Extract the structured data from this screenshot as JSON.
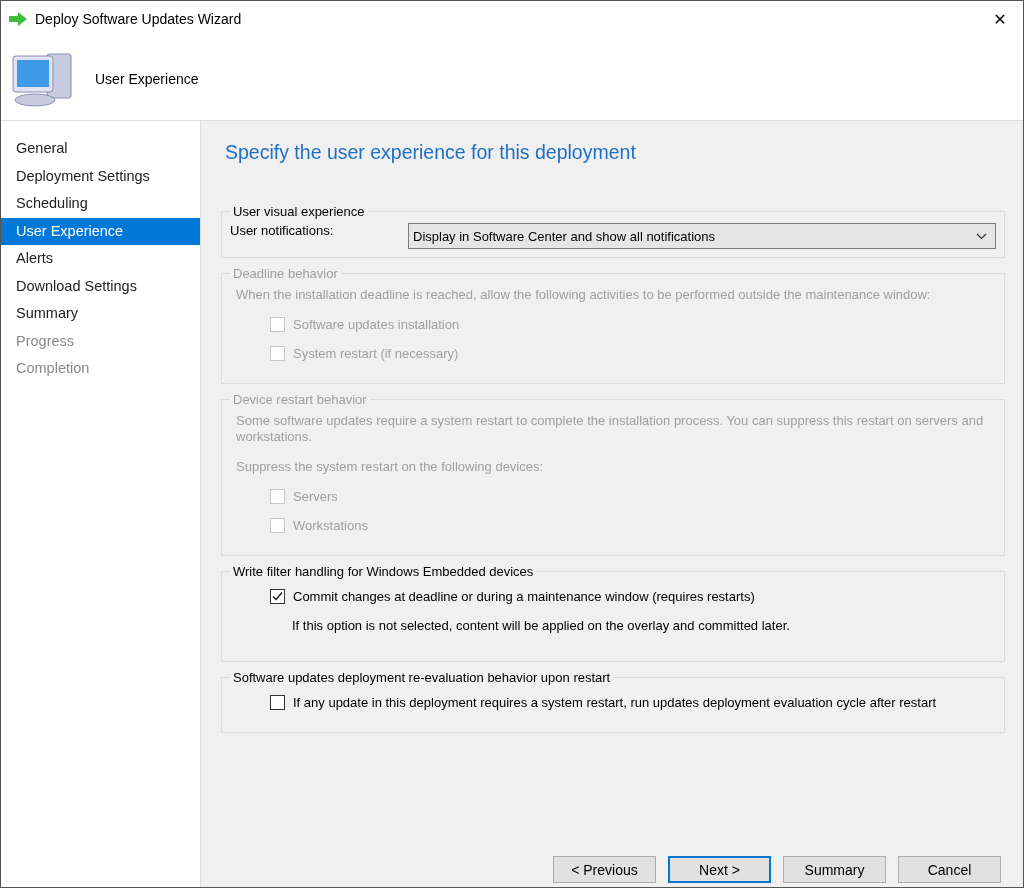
{
  "window": {
    "title": "Deploy Software Updates Wizard",
    "close": "✕"
  },
  "header": {
    "title": "User Experience"
  },
  "sidebar": {
    "items": [
      {
        "label": "General",
        "selected": false,
        "disabled": false
      },
      {
        "label": "Deployment Settings",
        "selected": false,
        "disabled": false
      },
      {
        "label": "Scheduling",
        "selected": false,
        "disabled": false
      },
      {
        "label": "User Experience",
        "selected": true,
        "disabled": false
      },
      {
        "label": "Alerts",
        "selected": false,
        "disabled": false
      },
      {
        "label": "Download Settings",
        "selected": false,
        "disabled": false
      },
      {
        "label": "Summary",
        "selected": false,
        "disabled": false
      },
      {
        "label": "Progress",
        "selected": false,
        "disabled": true
      },
      {
        "label": "Completion",
        "selected": false,
        "disabled": true
      }
    ]
  },
  "page": {
    "heading": "Specify the user experience for this deployment"
  },
  "groups": [
    {
      "legend": "User visual experience",
      "disabled": false,
      "items": [
        {
          "kind": "dropdown",
          "label": "User notifications:",
          "value": "Display in Software Center and show all notifications"
        }
      ]
    },
    {
      "legend": "Deadline behavior",
      "disabled": true,
      "items": [
        {
          "kind": "text",
          "text": "When the installation deadline is reached, allow the following activities to be performed outside the maintenance window:"
        },
        {
          "kind": "checkbox",
          "label": "Software updates installation",
          "checked": false
        },
        {
          "kind": "checkbox",
          "label": "System restart (if necessary)",
          "checked": false
        }
      ]
    },
    {
      "legend": "Device restart behavior",
      "disabled": true,
      "items": [
        {
          "kind": "text",
          "text": "Some software updates require a system restart to complete the installation process. You can suppress this restart on servers and workstations."
        },
        {
          "kind": "text",
          "text": "Suppress the system restart on the following devices:"
        },
        {
          "kind": "checkbox",
          "label": "Servers",
          "checked": false
        },
        {
          "kind": "checkbox",
          "label": "Workstations",
          "checked": false
        }
      ]
    },
    {
      "legend": "Write filter handling for Windows Embedded devices",
      "disabled": false,
      "items": [
        {
          "kind": "checkbox",
          "label": "Commit changes at deadline or during a maintenance window (requires restarts)",
          "checked": true
        },
        {
          "kind": "note",
          "text": "If this option is not selected, content will be applied on the overlay and committed later."
        }
      ]
    },
    {
      "legend": "Software updates deployment re-evaluation behavior upon restart",
      "disabled": false,
      "items": [
        {
          "kind": "checkbox",
          "label": "If any update in this deployment requires a system restart, run updates deployment evaluation cycle after restart",
          "checked": false
        }
      ]
    }
  ],
  "buttons": [
    {
      "label": "< Previous",
      "default": false
    },
    {
      "label": "Next >",
      "default": true
    },
    {
      "label": "Summary",
      "default": false
    },
    {
      "label": "Cancel",
      "default": false
    }
  ]
}
